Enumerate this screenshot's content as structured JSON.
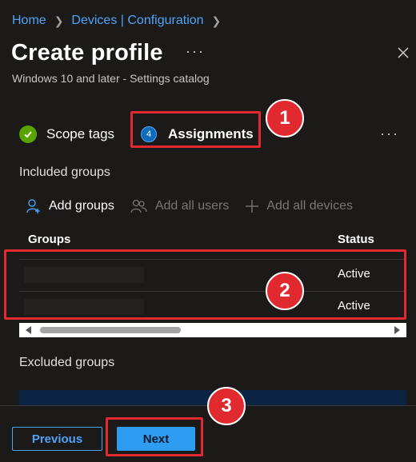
{
  "breadcrumb": [
    {
      "label": "Home"
    },
    {
      "label": "Devices | Configuration"
    }
  ],
  "page": {
    "title": "Create profile",
    "subtitle": "Windows 10 and later - Settings catalog"
  },
  "tabs": [
    {
      "label": "Scope tags",
      "state": "completed"
    },
    {
      "label": "Assignments",
      "number": "4",
      "state": "current"
    }
  ],
  "included": {
    "label": "Included groups",
    "commands": [
      {
        "label": "Add groups",
        "icon": "add-user-icon",
        "enabled": true
      },
      {
        "label": "Add all users",
        "icon": "group-icon",
        "enabled": false
      },
      {
        "label": "Add all devices",
        "icon": "plus-icon",
        "enabled": false
      }
    ],
    "columns": [
      "Groups",
      "Status"
    ],
    "rows": [
      {
        "group": "",
        "status": "Active"
      },
      {
        "group": "",
        "status": "Active"
      }
    ]
  },
  "excluded": {
    "label": "Excluded groups"
  },
  "footer": {
    "previous_label": "Previous",
    "next_label": "Next"
  },
  "callouts": [
    "1",
    "2",
    "3"
  ],
  "colors": {
    "background": "#1b1a19",
    "link": "#4fa3f7",
    "primary_button": "#2e9cf0",
    "callout_red": "#e12a2f",
    "success_green": "#57a300"
  }
}
